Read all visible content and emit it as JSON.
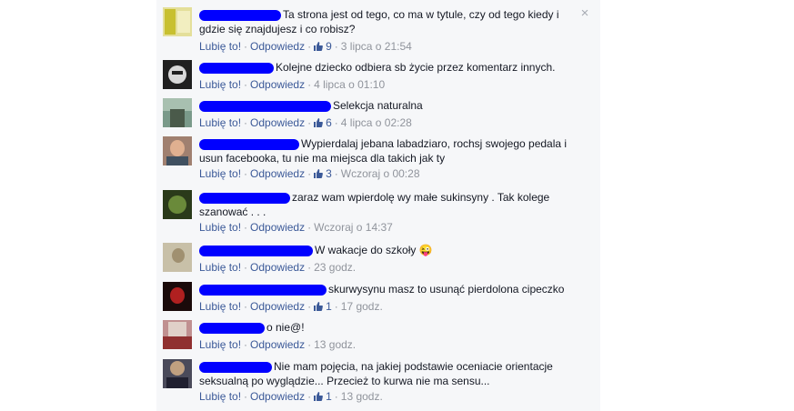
{
  "close_icon": "×",
  "actions": {
    "like": "Lubię to!",
    "reply": "Odpowiedz",
    "sep": "·"
  },
  "comments": [
    {
      "text": "Ta strona jest od tego, co ma w tytule, czy od tego kiedy i gdzie się znajdujesz i co robisz?",
      "likes": "9",
      "time": "3 lipca o 21:54",
      "avatar_color": "#d8c84a"
    },
    {
      "text": "Kolejne dziecko odbiera sb życie przez komentarz innych.",
      "likes": "",
      "time": "4 lipca o 01:10",
      "avatar_color": "#1a1a1a"
    },
    {
      "text": "Selekcja naturalna",
      "likes": "6",
      "time": "4 lipca o 02:28",
      "avatar_color": "#5a7a6a"
    },
    {
      "text": "Wypierdalaj jebana labadziaro, rochsj swojego pedala i usun facebooka, tu nie ma miejsca dla takich jak ty",
      "likes": "3",
      "time": "Wczoraj o 00:28",
      "avatar_color": "#8a6a5a"
    },
    {
      "text": "zaraz wam wpierdolę wy małe sukinsyny . Tak kolege szanować . . .",
      "likes": "",
      "time": "Wczoraj o 14:37",
      "avatar_color": "#3a4a2a"
    },
    {
      "text": "W wakacje do szkoły",
      "emoji": "😜",
      "likes": "",
      "time": "23 godz.",
      "avatar_color": "#b0a890"
    },
    {
      "text": "skurwysynu masz to usunąć pierdolona cipeczko",
      "likes": "1",
      "time": "17 godz.",
      "avatar_color": "#7a1010"
    },
    {
      "text": "o nie@!",
      "likes": "",
      "time": "13 godz.",
      "avatar_color": "#8a5a5a"
    },
    {
      "text": "Nie mam pojęcia, na jakiej podstawie oceniacie orientacje seksualną po wyglądzie... Przecież to kurwa nie ma sensu...",
      "likes": "1",
      "time": "13 godz.",
      "avatar_color": "#3a3a4a"
    }
  ]
}
